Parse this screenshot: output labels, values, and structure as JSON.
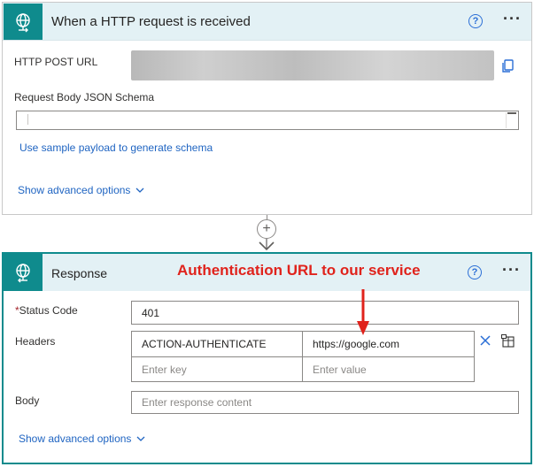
{
  "trigger": {
    "title": "When a HTTP request is received",
    "icon": "globe-request-icon",
    "url_label": "HTTP POST URL",
    "schema_label": "Request Body JSON Schema",
    "schema_value": "",
    "sample_link": "Use sample payload to generate schema",
    "advanced_label": "Show advanced options"
  },
  "connector": {
    "add_symbol": "+"
  },
  "annotation": {
    "text": "Authentication URL to our service",
    "color": "#e0231c"
  },
  "response": {
    "title": "Response",
    "icon": "globe-response-icon",
    "status_label": "Status Code",
    "status_required_mark": "*",
    "status_value": "401",
    "headers_label": "Headers",
    "headers": [
      {
        "key": "ACTION-AUTHENTICATE",
        "value": "https://google.com"
      }
    ],
    "header_key_placeholder": "Enter key",
    "header_value_placeholder": "Enter value",
    "body_label": "Body",
    "body_placeholder": "Enter response content",
    "advanced_label": "Show advanced options"
  },
  "colors": {
    "accent": "#0f8b8d",
    "header_bg": "#e3f1f5",
    "link": "#2065c2"
  }
}
